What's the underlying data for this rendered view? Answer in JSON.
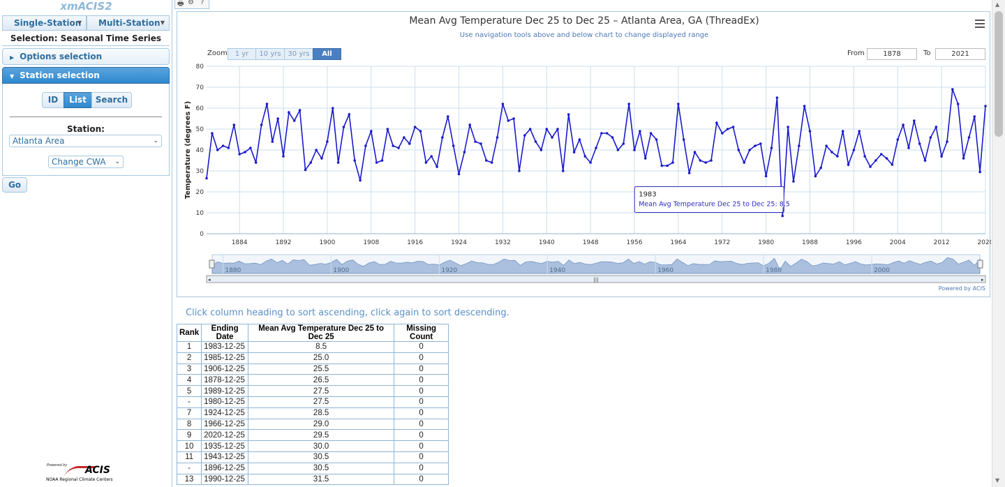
{
  "app": {
    "title": "xmACIS2"
  },
  "left_panel": {
    "single_station_label": "Single-Station",
    "multi_station_label": "Multi-Station",
    "selection_label": "Selection: Seasonal Time Series",
    "options_header": "Options selection",
    "station_header": "Station selection",
    "tabs": [
      "ID",
      "List",
      "Search"
    ],
    "station_label": "Station:",
    "station_value": "Atlanta Area",
    "cwa_value": "Change CWA",
    "go_label": "Go",
    "powered_small": "Powered by",
    "powered_logo": "ACIS",
    "powered_sub": "NOAA Regional Climate Centers"
  },
  "chart": {
    "title": "Mean Avg Temperature Dec 25 to Dec 25 – Atlanta Area, GA (ThreadEx)",
    "subtitle": "Use navigation tools above and below chart to change displayed range",
    "zoom_label": "Zoom",
    "zoom_buttons": [
      "1 yr",
      "10 yrs",
      "30 yrs",
      "All"
    ],
    "from_label": "From",
    "from_value": "1878",
    "to_label": "To",
    "to_value": "2021",
    "tooltip_year": "1983",
    "tooltip_text": "Mean Avg Temperature Dec 25 to Dec 25: 8.5",
    "credit": "Powered by ACIS",
    "line_color": "#1a1acc"
  },
  "chart_data": {
    "type": "line",
    "ylabel": "Temperature (degrees F)",
    "ylim": [
      0,
      80
    ],
    "yticks": [
      0,
      10,
      20,
      30,
      40,
      50,
      60,
      70,
      80
    ],
    "xticks": [
      1884,
      1892,
      1900,
      1908,
      1916,
      1924,
      1932,
      1940,
      1948,
      1956,
      1964,
      1972,
      1980,
      1988,
      1996,
      2004,
      2012,
      2020
    ],
    "navigator_ticks": [
      1880,
      1900,
      1920,
      1940,
      1960,
      1980,
      2000
    ],
    "series": [
      {
        "x_start": 1878,
        "values": [
          26.5,
          48,
          40,
          42,
          41,
          52,
          38,
          39,
          41,
          34,
          52,
          62,
          44,
          55,
          37,
          58,
          54,
          59,
          30.5,
          34,
          40,
          36,
          44,
          60,
          34,
          51,
          57,
          35,
          25.5,
          42,
          49,
          34,
          35,
          50,
          42,
          41,
          46,
          43,
          51,
          49,
          34,
          37,
          32,
          46,
          56,
          42,
          28.5,
          39,
          52,
          44,
          43,
          35,
          34,
          46,
          62,
          54,
          55,
          30,
          47,
          50,
          44,
          40,
          50,
          46,
          50,
          30,
          57,
          39,
          45,
          37,
          34,
          41,
          48,
          48,
          46,
          40,
          43,
          62,
          40,
          49,
          36,
          48,
          45,
          32.5,
          32.5,
          34,
          62,
          45,
          29,
          39,
          35,
          34,
          35,
          53,
          48,
          50,
          51,
          40,
          34,
          40,
          42,
          43,
          27.5,
          41,
          65,
          8.5,
          51,
          25,
          42,
          61,
          49,
          27.5,
          31.5,
          42,
          39,
          37,
          49,
          33,
          40,
          49,
          37,
          32,
          35,
          38,
          36,
          33,
          45,
          52,
          41,
          54,
          43,
          35,
          46,
          51,
          37,
          44,
          69,
          62,
          36,
          46,
          56,
          29.5,
          61
        ]
      }
    ]
  },
  "table": {
    "hint": "Click column heading to sort ascending, click again to sort descending.",
    "headers": [
      "Rank",
      "Ending Date",
      "Mean Avg Temperature Dec 25 to Dec 25",
      "Missing Count"
    ],
    "rows": [
      [
        "1",
        "1983-12-25",
        "8.5",
        "0"
      ],
      [
        "2",
        "1985-12-25",
        "25.0",
        "0"
      ],
      [
        "3",
        "1906-12-25",
        "25.5",
        "0"
      ],
      [
        "4",
        "1878-12-25",
        "26.5",
        "0"
      ],
      [
        "5",
        "1989-12-25",
        "27.5",
        "0"
      ],
      [
        "-",
        "1980-12-25",
        "27.5",
        "0"
      ],
      [
        "7",
        "1924-12-25",
        "28.5",
        "0"
      ],
      [
        "8",
        "1966-12-25",
        "29.0",
        "0"
      ],
      [
        "9",
        "2020-12-25",
        "29.5",
        "0"
      ],
      [
        "10",
        "1935-12-25",
        "30.0",
        "0"
      ],
      [
        "11",
        "1943-12-25",
        "30.5",
        "0"
      ],
      [
        "-",
        "1896-12-25",
        "30.5",
        "0"
      ],
      [
        "13",
        "1990-12-25",
        "31.5",
        "0"
      ]
    ]
  }
}
